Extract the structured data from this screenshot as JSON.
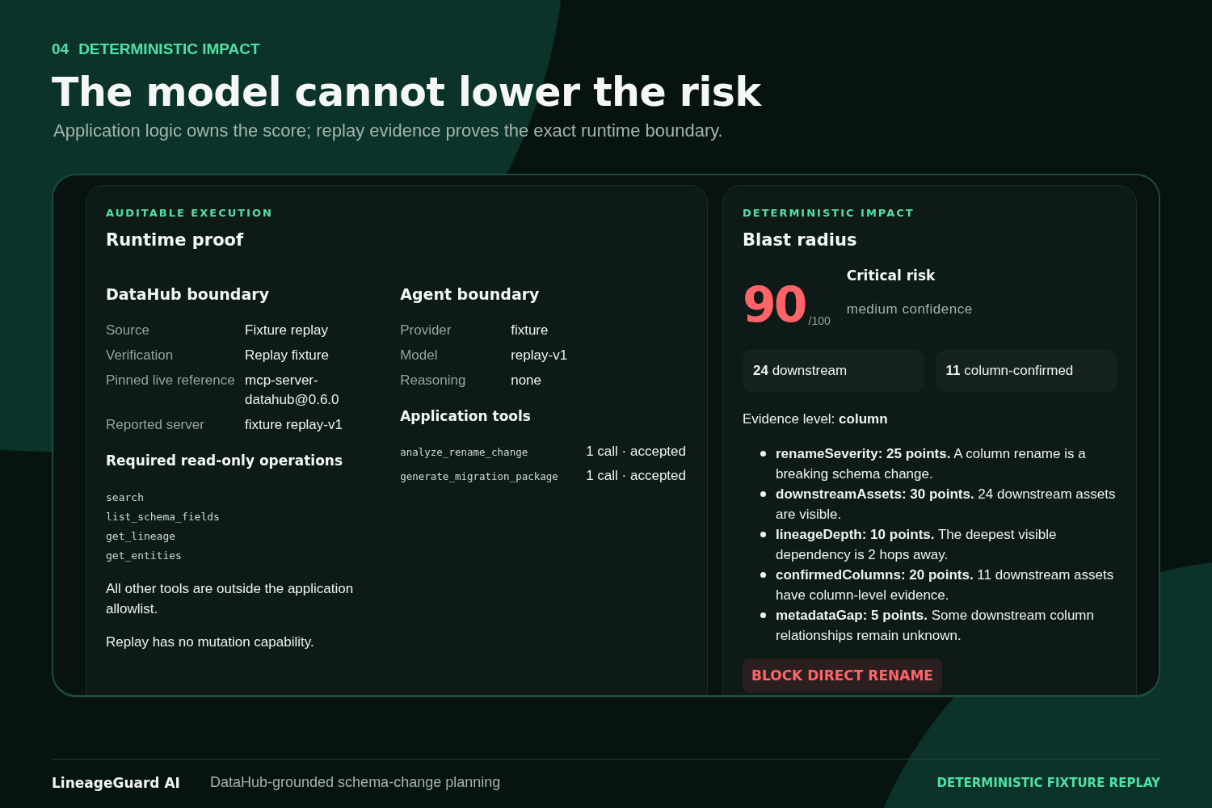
{
  "header": {
    "eyebrow_number": "04",
    "eyebrow": "DETERMINISTIC IMPACT",
    "title": "The model cannot lower the risk",
    "subtitle": "Application logic owns the score; replay evidence proves the exact runtime boundary."
  },
  "runtime_card": {
    "eyebrow": "AUDITABLE EXECUTION",
    "title": "Runtime proof",
    "datahub": {
      "title": "DataHub boundary",
      "rows": [
        {
          "label": "Source",
          "value": "Fixture replay"
        },
        {
          "label": "Verification",
          "value": "Replay fixture"
        },
        {
          "label": "Pinned live reference",
          "value": "mcp-server-datahub@0.6.0"
        },
        {
          "label": "Reported server",
          "value": "fixture replay-v1"
        }
      ]
    },
    "operations": {
      "title": "Required read-only operations",
      "items": [
        "search",
        "list_schema_fields",
        "get_lineage",
        "get_entities"
      ]
    },
    "notes": [
      "All other tools are outside the application allowlist.",
      "Replay has no mutation capability."
    ],
    "agent": {
      "title": "Agent boundary",
      "rows": [
        {
          "label": "Provider",
          "value": "fixture"
        },
        {
          "label": "Model",
          "value": "replay-v1"
        },
        {
          "label": "Reasoning",
          "value": "none"
        }
      ]
    },
    "tools": {
      "title": "Application tools",
      "items": [
        {
          "name": "analyze_rename_change",
          "status": "1 call · accepted"
        },
        {
          "name": "generate_migration_package",
          "status": "1 call · accepted"
        }
      ]
    }
  },
  "impact_card": {
    "eyebrow": "DETERMINISTIC IMPACT",
    "title": "Blast radius",
    "score": "90",
    "score_max": "/100",
    "risk": "Critical risk",
    "confidence": "medium confidence",
    "stats": [
      "**24** downstream",
      "**11** column-confirmed"
    ],
    "evidence": "Evidence level: **column**",
    "factors": [
      "**renameSeverity: 25 points.** A column rename is a breaking schema change.",
      "**downstreamAssets: 30 points.** 24 downstream assets are visible.",
      "**lineageDepth: 10 points.** The deepest visible dependency is 2 hops away.",
      "**confirmedColumns: 20 points.** 11 downstream assets have column-level evidence.",
      "**metadataGap: 5 points.** Some downstream column relationships remain unknown."
    ],
    "action": "BLOCK DIRECT RENAME"
  },
  "footer": {
    "brand": "LineageGuard AI",
    "tagline": "DataHub-grounded schema-change planning",
    "mode": "DETERMINISTIC FIXTURE REPLAY"
  }
}
